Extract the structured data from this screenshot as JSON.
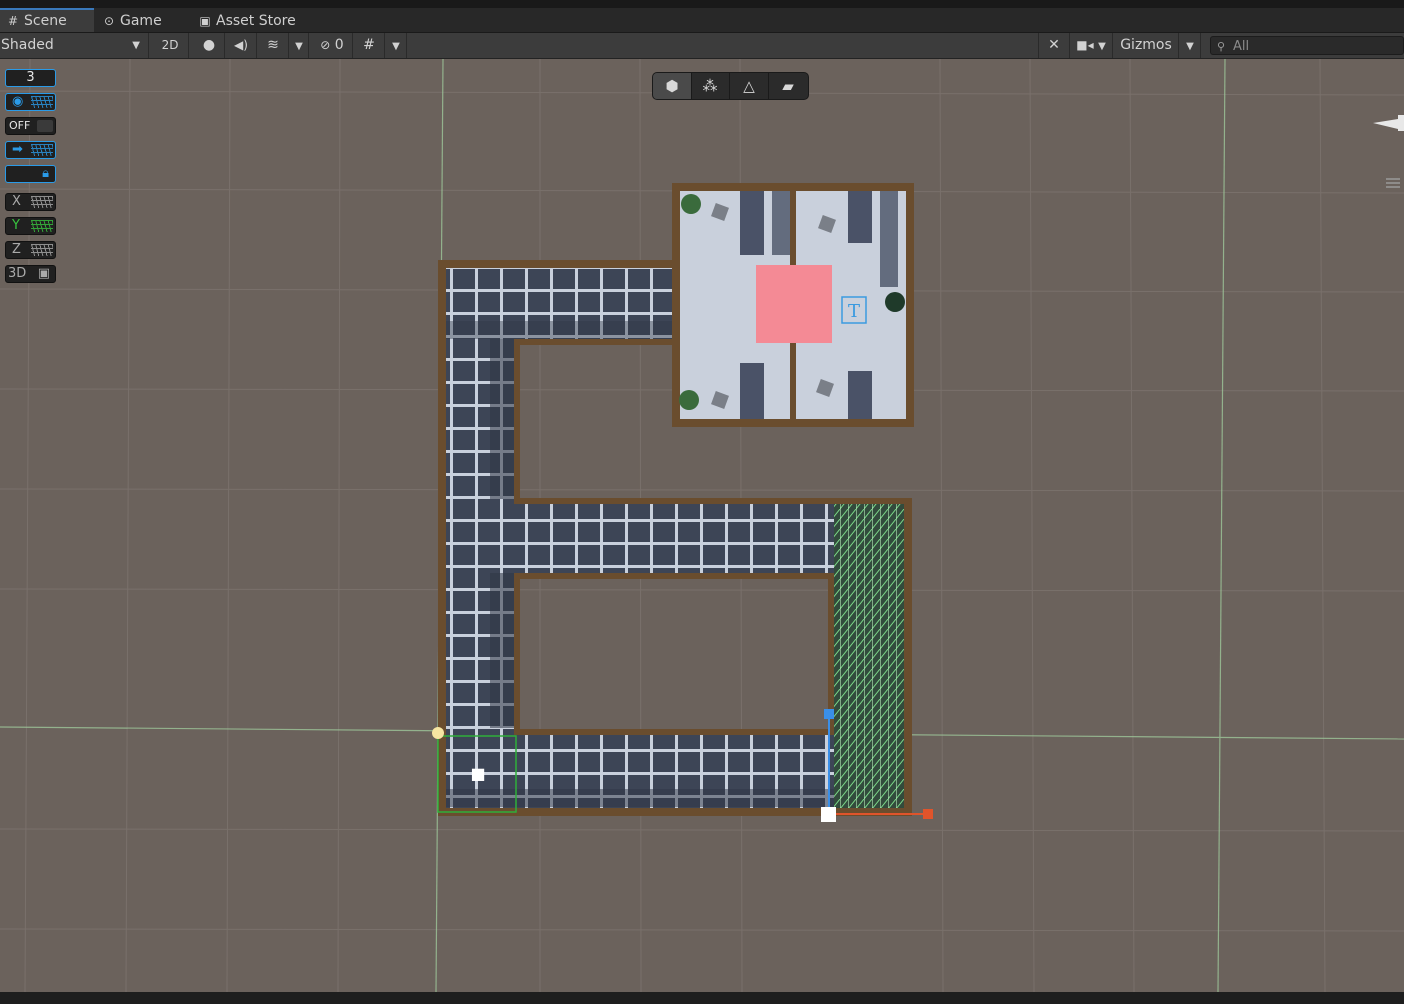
{
  "tabs": [
    {
      "label": "Scene",
      "icon": "grid-icon",
      "active": true
    },
    {
      "label": "Game",
      "icon": "gamepad-icon",
      "active": false
    },
    {
      "label": "Asset Store",
      "icon": "bag-icon",
      "active": false
    }
  ],
  "toolbar": {
    "shading_mode": "Shaded",
    "mode_2d": "2D",
    "hidden_count": "0",
    "gizmos_label": "Gizmos",
    "search_placeholder": "All"
  },
  "grid_overlay": {
    "layer_value": "3",
    "snap_off_label": "OFF",
    "axis_x": "X",
    "axis_y": "Y",
    "axis_z": "Z",
    "mode_3d": "3D"
  },
  "scene_tools": [
    "box-tool-icon",
    "vertex-tool-icon",
    "edge-tool-icon",
    "face-tool-icon"
  ],
  "scene": {
    "trigger_marker": "T",
    "colors": {
      "background": "#6b625c",
      "wall": "#6a4d2e",
      "floor_dark": "#3d4556",
      "floor_light": "#c9d0dc",
      "target_zone": "#f48a95",
      "gizmo_blue": "#3a8fe8",
      "gizmo_red": "#e0542b",
      "selection_green": "#2fae3a"
    }
  }
}
